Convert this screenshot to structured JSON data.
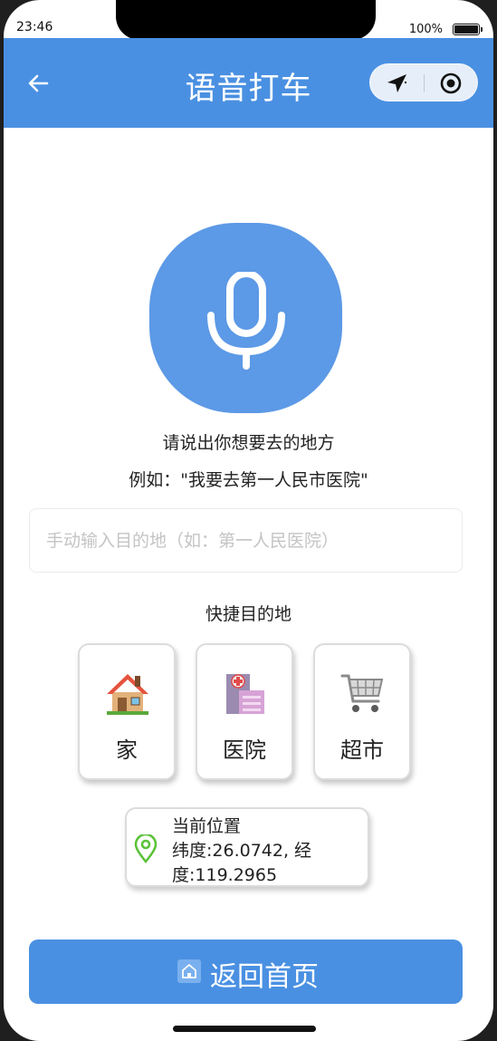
{
  "status_bar": {
    "time": "23:46",
    "battery_percent": "100%"
  },
  "nav": {
    "title": "语音打车",
    "back_icon": "arrow-left-icon",
    "capsule_icons": [
      "location-arrow-icon",
      "record-target-icon"
    ]
  },
  "voice": {
    "mic_icon": "microphone-icon",
    "prompt": "请说出你想要去的地方",
    "example": "例如：\"我要去第一人民市医院\""
  },
  "destination_input": {
    "value": "",
    "placeholder": "手动输入目的地（如：第一人民医院）"
  },
  "shortcuts": {
    "title": "快捷目的地",
    "items": [
      {
        "label": "家",
        "icon": "house-icon"
      },
      {
        "label": "医院",
        "icon": "hospital-icon"
      },
      {
        "label": "超市",
        "icon": "shopping-cart-icon"
      }
    ]
  },
  "location": {
    "title": "当前位置",
    "coords_line1": "纬度:26.0742, 经",
    "coords_line2": "度:119.2965",
    "icon": "map-pin-icon"
  },
  "home_button": {
    "label": "返回首页",
    "icon": "home-icon"
  },
  "colors": {
    "primary": "#4a90e2",
    "mic_bg": "#5c99e6",
    "pin_green": "#5cc23a"
  }
}
